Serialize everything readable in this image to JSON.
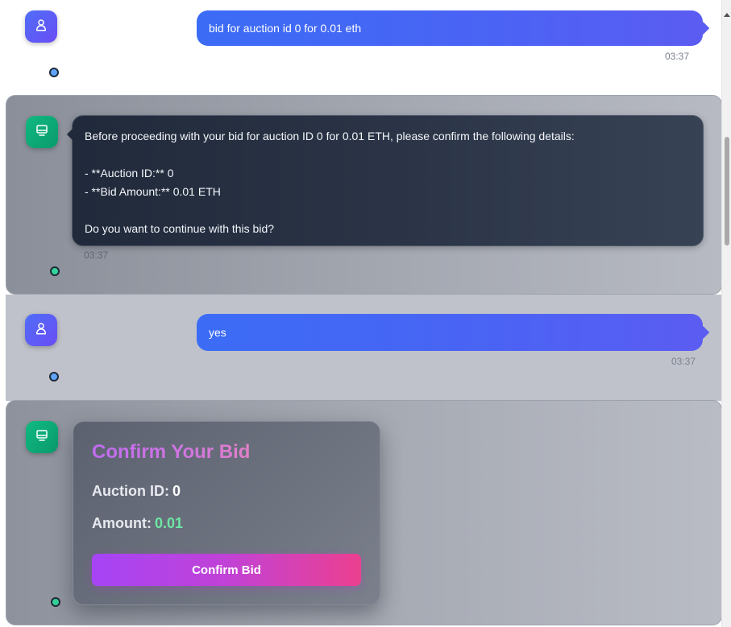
{
  "messages": [
    {
      "role": "user",
      "text": "bid for auction id 0 for 0.01 eth",
      "time": "03:37"
    },
    {
      "role": "assistant",
      "lines": [
        "Before proceeding with your bid for auction ID 0 for 0.01 ETH, please confirm the following details:",
        "",
        "- **Auction ID:** 0",
        "- **Bid Amount:** 0.01 ETH",
        "",
        "Do you want to continue with this bid?"
      ],
      "time": "03:37"
    },
    {
      "role": "user",
      "text": "yes",
      "time": "03:37"
    },
    {
      "role": "assistant",
      "card": {
        "title": "Confirm Your Bid",
        "auction_label": "Auction ID:",
        "auction_value": "0",
        "amount_label": "Amount:",
        "amount_value": "0.01",
        "button_label": "Confirm Bid"
      }
    }
  ],
  "icons": {
    "user_avatar": "user-icon",
    "bot_avatar": "monitor-icon"
  },
  "colors": {
    "user_bubble": "#3b6cf6",
    "bot_bubble": "#202a3b",
    "user_avatar": "#4f6ef7",
    "bot_avatar": "#10b981",
    "amount_value": "#6ee7a5",
    "button_start": "#a644f6",
    "button_end": "#ec4090"
  }
}
